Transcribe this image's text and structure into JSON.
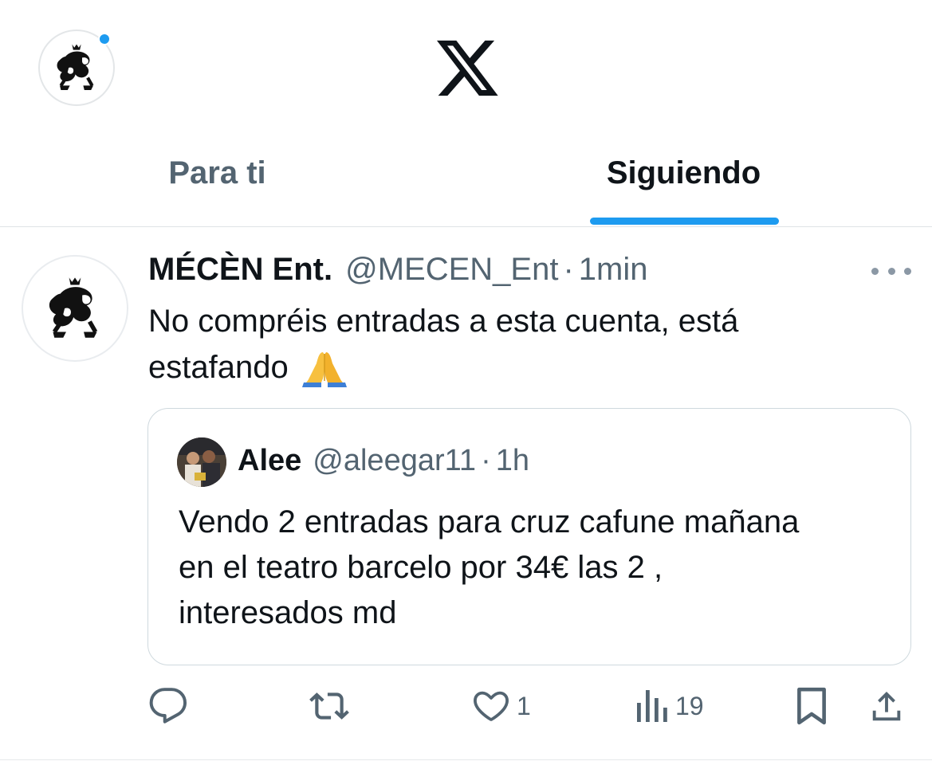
{
  "header": {
    "avatar_icon": "lion-crest-logo",
    "logo_icon": "x-logo"
  },
  "tabs": [
    {
      "label": "Para ti",
      "active": false
    },
    {
      "label": "Siguiendo",
      "active": true
    }
  ],
  "post": {
    "author_name": "MÉCÈN Ent.",
    "author_handle": "@MECEN_Ent",
    "separator": "·",
    "time": "1min",
    "text_line1": "No compréis entradas a esta cuenta, está",
    "text_line2": "estafando",
    "emoji_icon": "folded-hands-emoji",
    "quote": {
      "author_name": "Alee",
      "author_handle": "@aleegar11",
      "separator": "·",
      "time": "1h",
      "text_line1": "Vendo 2 entradas para cruz cafune mañana",
      "text_line2": "en el teatro barcelo por 34€ las 2 ,",
      "text_line3": "interesados md"
    },
    "actions": {
      "reply_count": "",
      "repost_count": "",
      "like_count": "1",
      "views_count": "19"
    }
  },
  "colors": {
    "accent": "#1d9bf0",
    "secondary_text": "#536471",
    "primary_text": "#0f1419"
  }
}
